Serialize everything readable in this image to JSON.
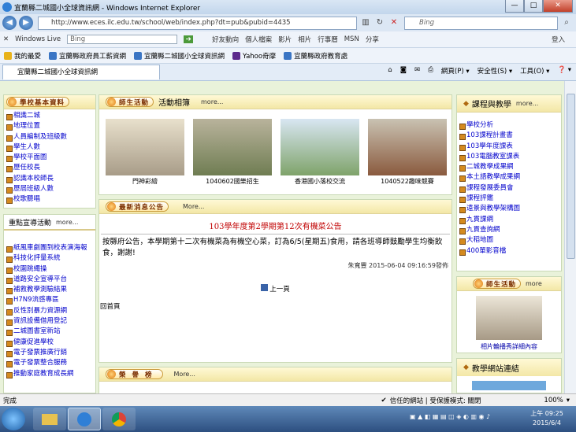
{
  "window": {
    "title": "宜蘭縣二城國小全球資訊網 - Windows Internet Explorer",
    "min": "—",
    "max": "□",
    "close": "✕"
  },
  "address": {
    "url": "http://www.eces.ilc.edu.tw/school/web/index.php?dt=pub&pubid=4435",
    "search_placeholder": "Bing"
  },
  "live_toolbar": {
    "close": "✕",
    "brand": "Windows Live",
    "search": "Bing",
    "items": [
      "好友動向",
      "個人檔案",
      "影片",
      "相片",
      "行事曆",
      "MSN",
      "分享"
    ],
    "signin": "登入"
  },
  "favorites": {
    "label": "我的最愛",
    "items": [
      "宜蘭縣政府員工薪資網",
      "宜蘭縣二城國小全球資訊網",
      "Yahoo奇摩",
      "宜蘭縣政府教育處"
    ]
  },
  "tab": {
    "label": "宜蘭縣二城國小全球資訊網"
  },
  "commands": {
    "page": "網頁(P) ▾",
    "safety": "安全性(S) ▾",
    "tools": "工具(O) ▾",
    "help": "❓ ▾"
  },
  "left": {
    "section1_title": "學校基本資料",
    "section1_items": [
      "相識二城",
      "地理位置",
      "人員編制及班級數",
      "學生人數",
      "學校平面圖",
      "歷任校長",
      "認識本校師長",
      "歷屆班級人數",
      "校歌聽唱"
    ],
    "section2_title": "重點宣導活動",
    "section2_more": "more...",
    "section2_items": [
      "紙風車劇團到校表演海報",
      "科技化評量系統",
      "校園跳繩操",
      "道路安全宣導平台",
      "補救教學測驗結果",
      "H7N9流感專區",
      "反性別暴力資源網",
      "資訊設備借用登記",
      "二城圖書室新站",
      "健康促進學校",
      "電子發票推廣行銷",
      "電子發票整合服務",
      "推動家庭教育成長網"
    ]
  },
  "center": {
    "activity_title": "師生活動",
    "activity_label": "活動相簿",
    "activity_more": "more...",
    "photos": [
      "門神彩繪",
      "1040602國樂招生",
      "香港國小落校交流",
      "1040522趣味競賽"
    ],
    "news_title": "最新消息公告",
    "news_more": "More...",
    "announce_title": "103學年度第2學期第12次有機菜公告",
    "announce_body": "按縣府公告，本學期第十二次有機菜為有機空心菜，訂為6/5(星期五)食用，請各班導師鼓勵學生均衡飲食，謝謝!",
    "announce_meta": "朱寬豐  2015-06-04 09:16:59發佈",
    "prev": "上一頁",
    "home": "回首頁",
    "honor_title": "榮譽榜",
    "honor_more": "More..."
  },
  "right": {
    "course_title": "課程與教學",
    "course_more": "more...",
    "course_items": [
      "學校分析",
      "103課程計畫書",
      "103學年度課表",
      "103電腦教室課表",
      "二城教學成果網",
      "本土語教學成果網",
      "課程發展委員會",
      "課程評鑑",
      "遠景與教學架構圖",
      "九貫課綱",
      "九貫查詢網",
      "大稻地圖",
      "400單影音檔"
    ],
    "activity_title": "師生活動",
    "activity_more": "more",
    "photo_caption": "相片輪播秀詳細內容",
    "links_title": "教學網站連結"
  },
  "status": {
    "left": "完成",
    "zone": "信任的網站 | 受保護模式: 關閉",
    "zoom": "100%"
  },
  "taskbar": {
    "time": "上午 09:25",
    "date": "2015/6/4"
  }
}
